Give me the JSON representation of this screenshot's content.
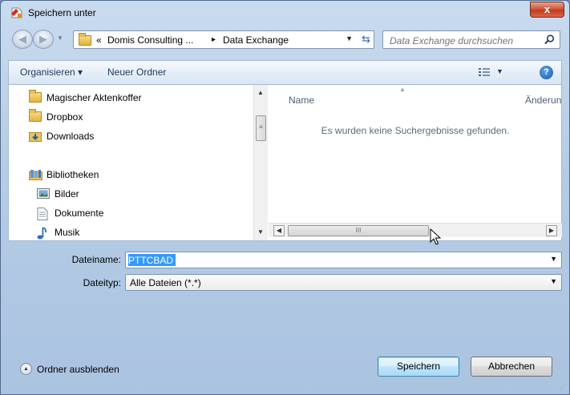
{
  "window": {
    "title": "Speichern unter",
    "close_label": "x"
  },
  "navigation": {
    "breadcrumb_prefix": "«",
    "crumbs": [
      "Domis Consulting ...",
      "Data Exchange"
    ],
    "separator": "▸",
    "search_placeholder": "Data Exchange durchsuchen"
  },
  "toolbar": {
    "organize_label": "Organisieren ▾",
    "new_folder_label": "Neuer Ordner"
  },
  "nav_pane": {
    "items": [
      {
        "label": "Magischer Aktenkoffer",
        "icon": "folder-icon"
      },
      {
        "label": "Dropbox",
        "icon": "folder-icon"
      },
      {
        "label": "Downloads",
        "icon": "downloads-folder-icon"
      },
      {
        "label": "Bibliotheken",
        "icon": "libraries-icon"
      },
      {
        "label": "Bilder",
        "icon": "pictures-icon"
      },
      {
        "label": "Dokumente",
        "icon": "documents-icon"
      },
      {
        "label": "Musik",
        "icon": "music-icon"
      }
    ]
  },
  "file_pane": {
    "columns": [
      "Name",
      "Änderungsdatum"
    ],
    "empty_message": "Es wurden keine Suchergebnisse gefunden."
  },
  "form": {
    "filename_label": "Dateiname:",
    "filename_value": "PTTCBAD",
    "filetype_label": "Dateityp:",
    "filetype_value": "Alle Dateien (*.*)"
  },
  "footer": {
    "toggle_label": "Ordner ausblenden",
    "save_label": "Speichern",
    "cancel_label": "Abbrechen"
  },
  "colors": {
    "accent": "#3399ff",
    "close": "#c23b1e",
    "link_text": "#1e395b"
  }
}
